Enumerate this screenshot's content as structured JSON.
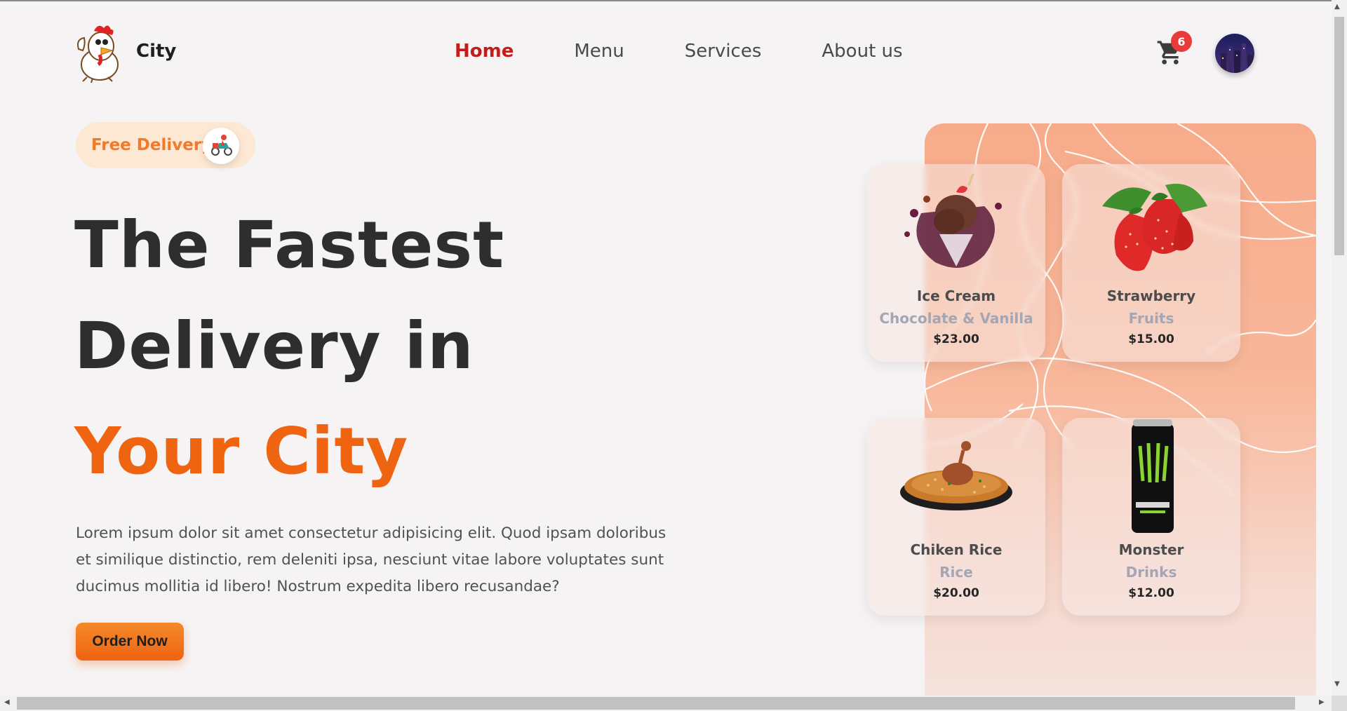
{
  "brand": {
    "name": "City",
    "logo_icon": "chicken-mascot-icon"
  },
  "nav": {
    "items": [
      {
        "label": "Home",
        "active": true
      },
      {
        "label": "Menu",
        "active": false
      },
      {
        "label": "Services",
        "active": false
      },
      {
        "label": "About us",
        "active": false
      }
    ]
  },
  "cart": {
    "icon": "cart-icon",
    "count": "6"
  },
  "user": {
    "avatar_icon": "avatar-icon"
  },
  "hero": {
    "badge": {
      "label": "Free Delivery",
      "icon": "scooter-delivery-icon"
    },
    "line1": "The Fastest",
    "line2": "Delivery in",
    "line3": "Your City",
    "description": "Lorem ipsum dolor sit amet consectetur adipisicing elit. Quod ipsam doloribus et similique distinctio, rem deleniti ipsa, nesciunt vitae labore voluptates sunt ducimus mollitia id libero! Nostrum expedita libero recusandae?",
    "cta": "Order Now"
  },
  "products": [
    {
      "name": "Ice Cream",
      "category": "Chocolate & Vanilla",
      "price": "$23.00",
      "image": "ice-cream-image"
    },
    {
      "name": "Strawberry",
      "category": "Fruits",
      "price": "$15.00",
      "image": "strawberry-image"
    },
    {
      "name": "Chiken Rice",
      "category": "Rice",
      "price": "$20.00",
      "image": "chicken-rice-image"
    },
    {
      "name": "Monster",
      "category": "Drinks",
      "price": "$12.00",
      "image": "monster-can-image"
    }
  ],
  "colors": {
    "accent": "#ef6410",
    "nav_active": "#c41b1b",
    "badge_bg": "#fde8d4",
    "badge_text": "#f07a2a",
    "panel": "#f7ab8a",
    "cart_badge": "#ea3b3b"
  }
}
